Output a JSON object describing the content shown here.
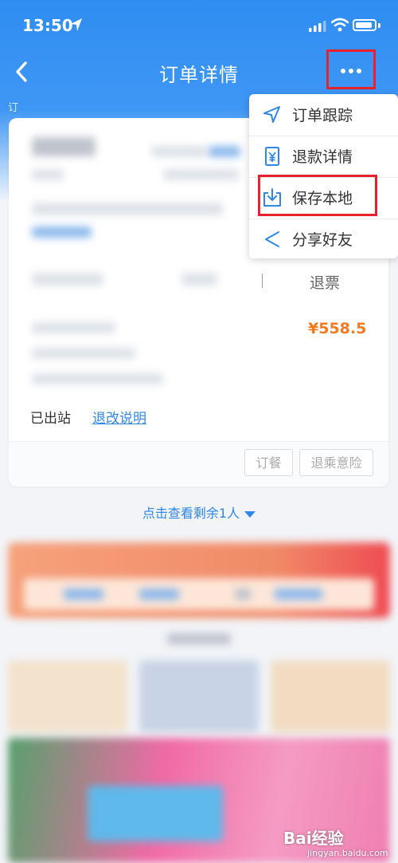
{
  "status_bar": {
    "time": "13:50"
  },
  "nav": {
    "title": "订单详情"
  },
  "partial_label": "订",
  "menu": {
    "items": [
      {
        "label": "订单跟踪",
        "icon": "navigation-arrow-icon"
      },
      {
        "label": "退款详情",
        "icon": "yuan-receipt-icon"
      },
      {
        "label": "保存本地",
        "icon": "download-save-icon"
      },
      {
        "label": "分享好友",
        "icon": "share-icon"
      }
    ]
  },
  "order": {
    "refund_label": "退票",
    "price": "¥558.5",
    "status": "已出站",
    "rules_link": "退改说明",
    "buttons": {
      "meal": "订餐",
      "insurance": "退乘意险"
    }
  },
  "view_rest": "点击查看剩余1人",
  "watermark": {
    "brand": "Bai经验",
    "url": "jingyan.baidu.com"
  },
  "colors": {
    "primary": "#2f8df2",
    "price": "#f4791f",
    "highlight": "#e8222c",
    "link": "#2e88e6"
  }
}
